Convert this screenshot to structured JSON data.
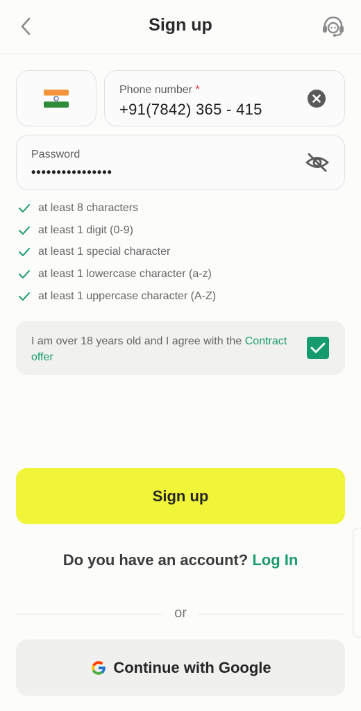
{
  "header": {
    "title": "Sign up",
    "back_icon": "chevron-left-icon",
    "support_icon": "headset-icon"
  },
  "country": {
    "flag": "india-flag-icon"
  },
  "phone": {
    "label": "Phone number",
    "required_mark": "*",
    "value": "+91(7842) 365 - 415",
    "clear_icon": "clear-icon"
  },
  "password": {
    "label": "Password",
    "masked_value": "••••••••••••••••",
    "visibility_icon": "eye-off-icon"
  },
  "rules": [
    "at least 8 characters",
    "at least 1 digit (0-9)",
    "at least 1 special character",
    "at least 1 lowercase character (a-z)",
    "at least 1 uppercase character (A-Z)"
  ],
  "agreement": {
    "text": "I am over 18 years old and I agree with the ",
    "link": "Contract offer",
    "checked": true
  },
  "signup_button": "Sign up",
  "account": {
    "question": "Do you have an account? ",
    "login": "Log In"
  },
  "divider_text": "or",
  "google_button": "Continue with Google",
  "colors": {
    "accent": "#1b9c6e",
    "button_yellow": "#f0f53a",
    "checkbox": "#159b6e",
    "required": "#e53935"
  }
}
